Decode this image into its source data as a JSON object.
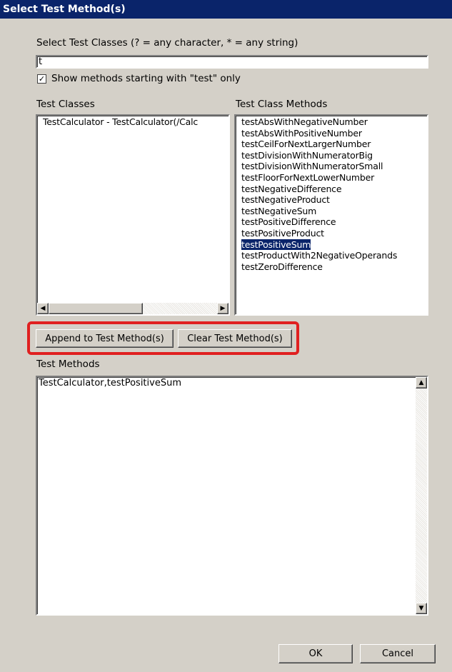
{
  "window": {
    "title": "Select Test Method(s)"
  },
  "filter": {
    "label": "Select Test Classes (? = any character, * = any string)",
    "value": "t",
    "checkbox_label": "Show methods starting with \"test\" only",
    "checkbox_checked": true,
    "check_mark": "✓"
  },
  "classes": {
    "label": "Test Classes",
    "items": [
      "TestCalculator - TestCalculator(/Calc"
    ]
  },
  "methods": {
    "label": "Test Class Methods",
    "items": [
      "testAbsWithNegativeNumber",
      "testAbsWithPositiveNumber",
      "testCeilForNextLargerNumber",
      "testDivisionWithNumeratorBig",
      "testDivisionWithNumeratorSmall",
      "testFloorForNextLowerNumber",
      "testNegativeDifference",
      "testNegativeProduct",
      "testNegativeSum",
      "testPositiveDifference",
      "testPositiveProduct",
      "testPositiveSum",
      "testProductWith2NegativeOperands",
      "testZeroDifference"
    ],
    "selected": "testPositiveSum"
  },
  "actions": {
    "append_label": "Append to Test Method(s)",
    "clear_label": "Clear Test Method(s)",
    "highlight_color": "#e02020"
  },
  "test_methods": {
    "label": "Test Methods",
    "value": "TestCalculator,testPositiveSum"
  },
  "footer": {
    "ok_label": "OK",
    "cancel_label": "Cancel"
  },
  "colors": {
    "titlebar": "#0a246a",
    "dialog_bg": "#d4d0c8",
    "selection": "#0a246a"
  }
}
